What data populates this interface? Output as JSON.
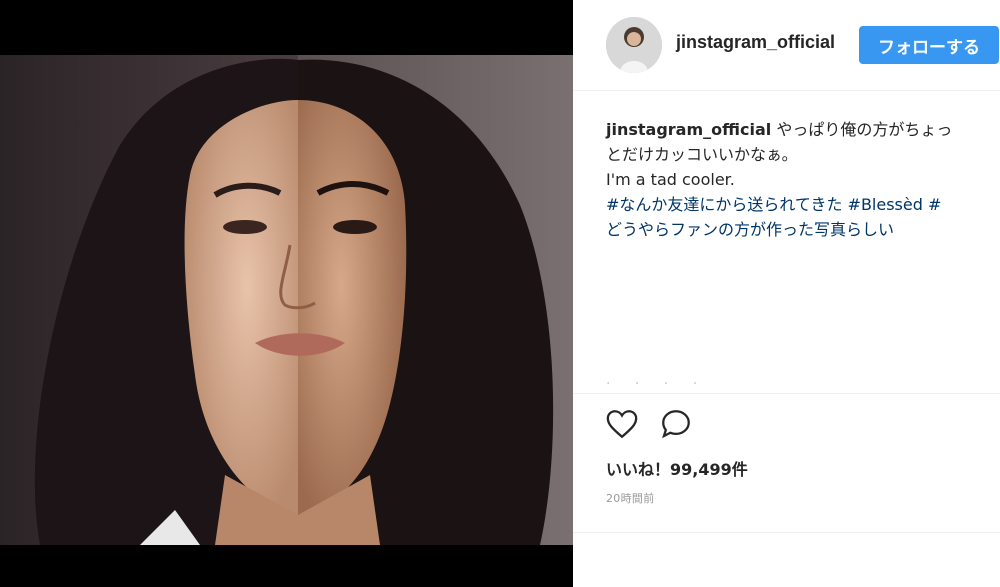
{
  "post": {
    "image_alt": "",
    "username": "jinstagram_official",
    "follow_label": "フォローする",
    "caption": {
      "username": "jinstagram_official",
      "line1": "やっぱり俺の方がちょっ",
      "line2": "とだけカッコいいかなぁ。",
      "line3": "I'm a tad cooler.",
      "tag_line_prefix": "#なんか友達にから送られてきた",
      "tag1": "#Blessèd",
      "tag2": "#",
      "line5": "どうやらファンの方が作った写真らしい"
    },
    "faded_text": "· · · ·",
    "likes": "いいね！99,499件",
    "time": "20時間前"
  },
  "icons": {
    "heart": "heart-outline-icon",
    "comment": "comment-bubble-icon"
  },
  "colors": {
    "follow_button": "#3897f0",
    "hashtag": "#003569",
    "text": "#262626",
    "muted": "#999999"
  }
}
